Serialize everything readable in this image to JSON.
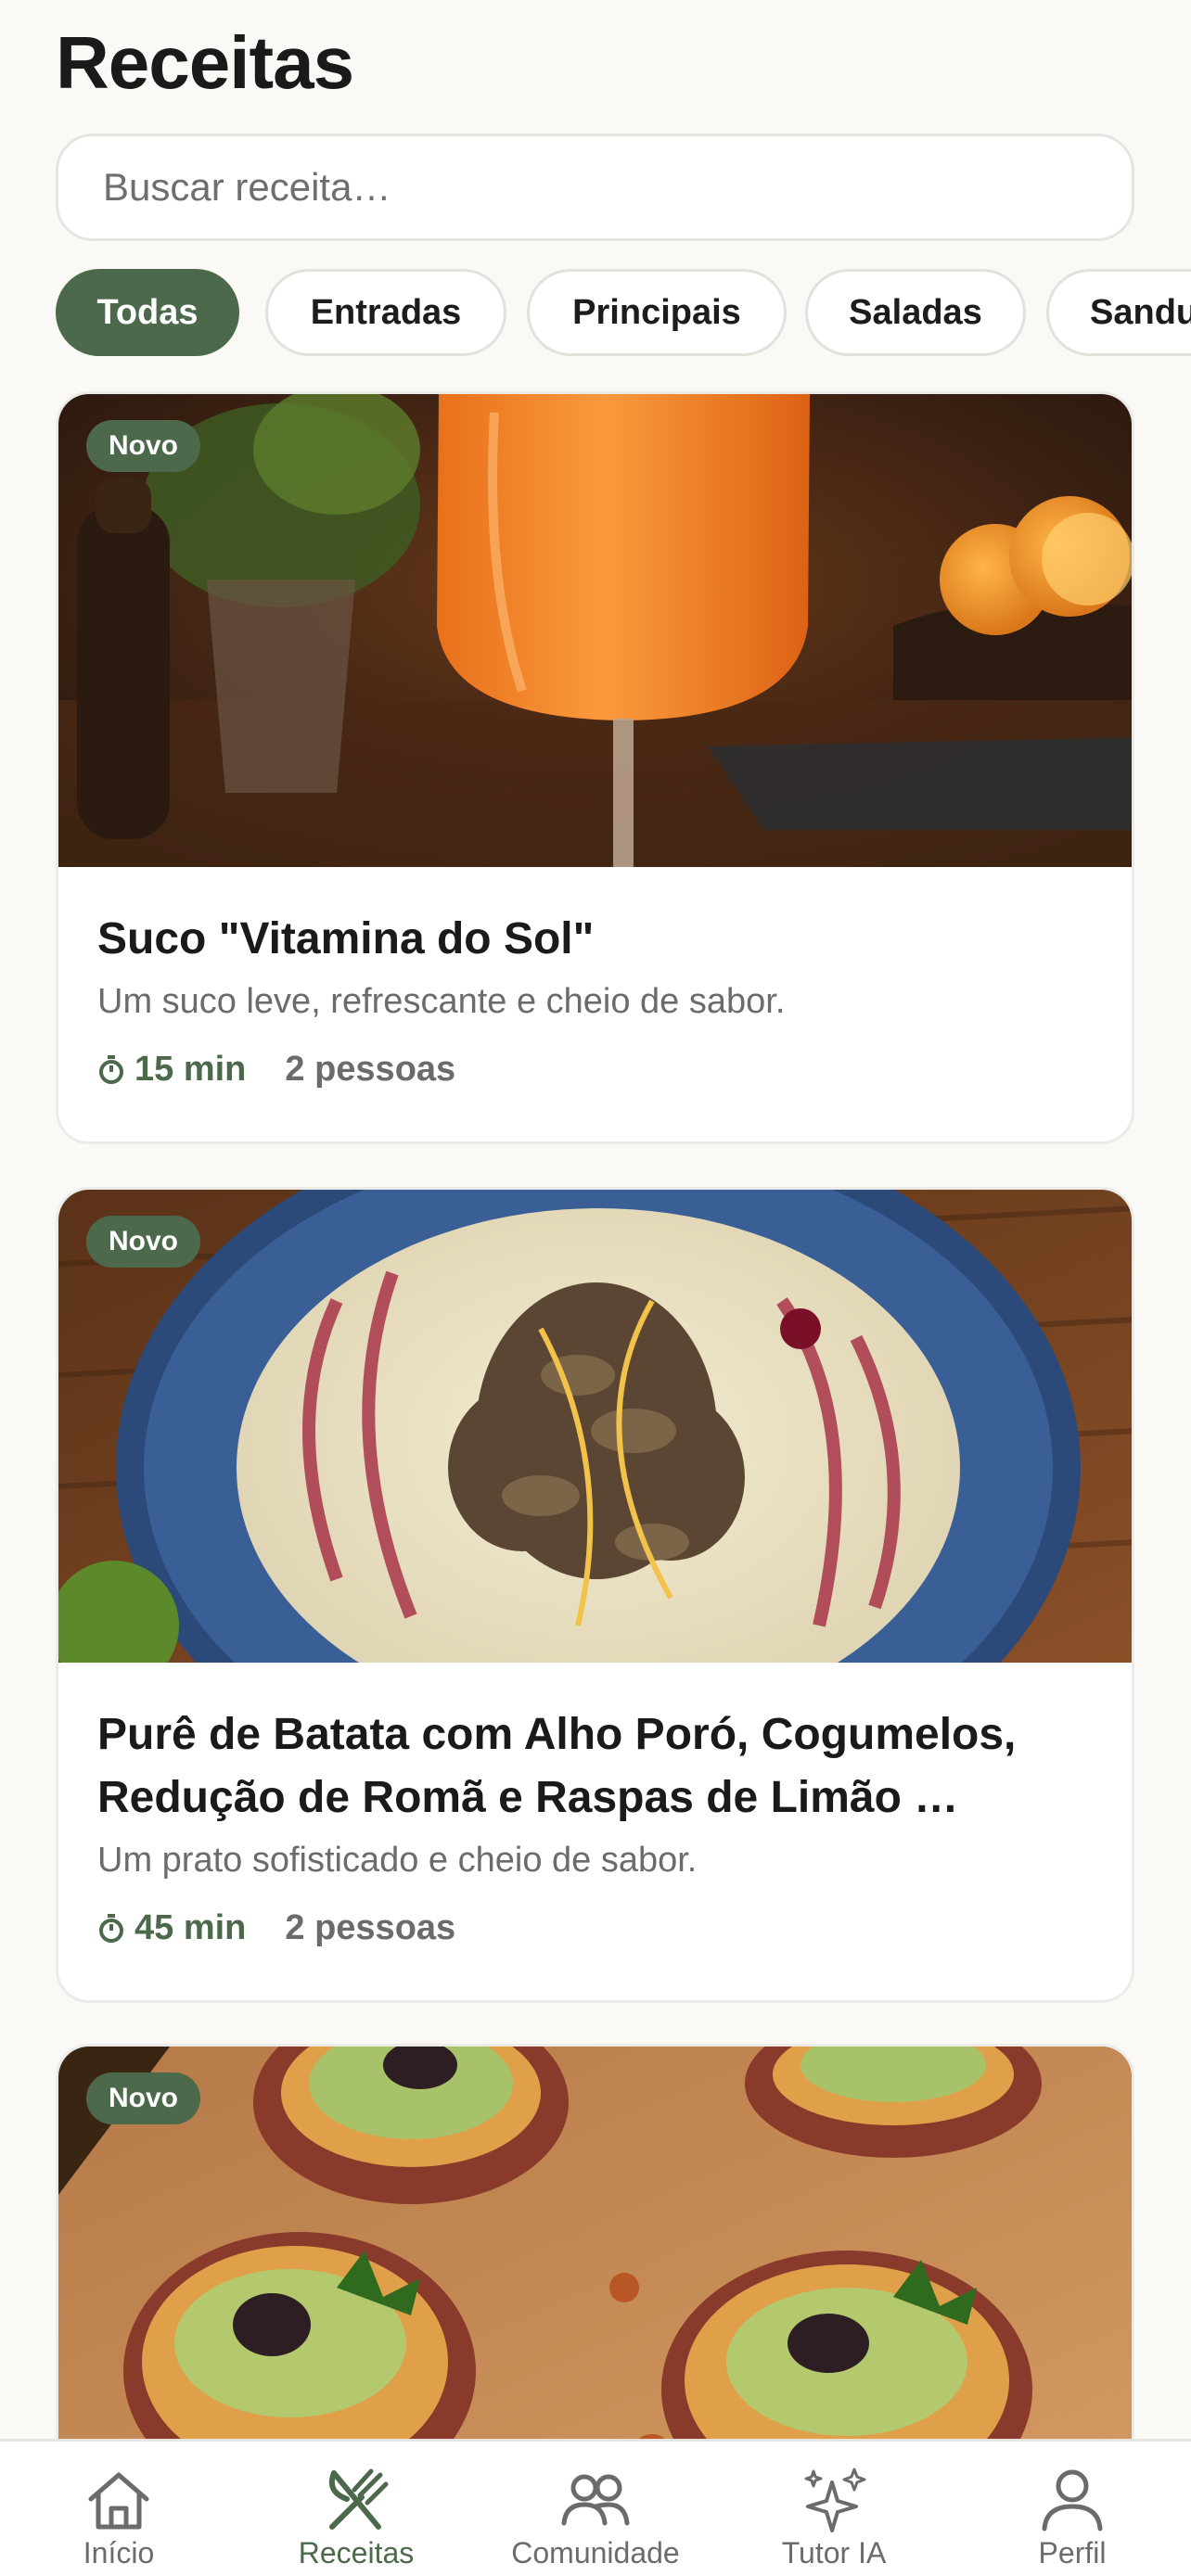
{
  "header": {
    "title": "Receitas"
  },
  "search": {
    "placeholder": "Buscar receita…"
  },
  "filters": [
    "Todas",
    "Entradas",
    "Principais",
    "Saladas",
    "Sanduíches"
  ],
  "recipes": [
    {
      "badge": "Novo",
      "title": "Suco \"Vitamina do Sol\"",
      "description": "Um suco leve, refrescante e cheio de sabor.",
      "time": "15 min",
      "serves": "2 pessoas"
    },
    {
      "badge": "Novo",
      "title": "Purê de Batata com Alho Poró, Cogumelos, Redução de Romã e Raspas de Limão …",
      "description": "Um prato sofisticado e cheio de sabor.",
      "time": "45 min",
      "serves": "2 pessoas"
    },
    {
      "badge": "Novo"
    }
  ],
  "tabbar": [
    {
      "label": "Início",
      "icon": "home-icon"
    },
    {
      "label": "Receitas",
      "icon": "utensils-icon",
      "active": true
    },
    {
      "label": "Comunidade",
      "icon": "people-icon"
    },
    {
      "label": "Tutor IA",
      "icon": "sparkles-icon"
    },
    {
      "label": "Perfil",
      "icon": "user-icon"
    }
  ],
  "colors": {
    "accent": "#4c6a4b",
    "background": "#faf9f6",
    "muted_text": "#6b6b6b"
  }
}
